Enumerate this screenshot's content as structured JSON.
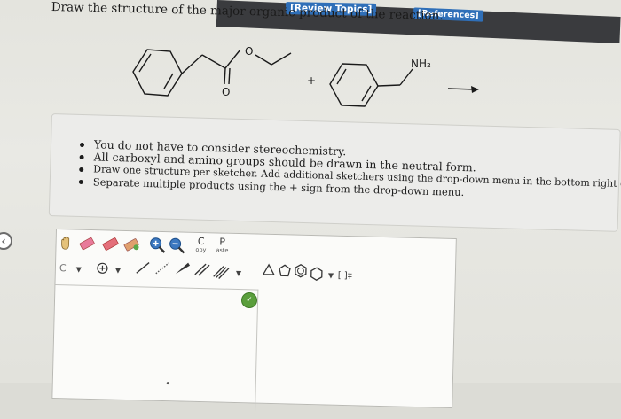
{
  "header": {
    "review_topics": "[Review Topics]",
    "references": "[References]"
  },
  "question": "Draw the structure of the major organic product of the reaction.",
  "reaction": {
    "reagent2_label": "NH₂",
    "plus": "+"
  },
  "instructions": [
    "You do not have to consider stereochemistry.",
    "All carboxyl and amino groups should be drawn in the neutral form.",
    "Draw one structure per sketcher. Add additional sketchers using the drop-down menu in the bottom right corner.",
    "Separate multiple products using the + sign from the drop-down menu."
  ],
  "toolbar": {
    "copy_main": "C",
    "copy_sub": "opy",
    "paste_main": "P",
    "paste_sub": "aste",
    "carbon_label": "C",
    "bracket_label": "[ ]‡"
  },
  "colors": {
    "accent": "#2f6fb8",
    "header_bar": "#3a3b3e",
    "help": "#5a9e3c"
  }
}
